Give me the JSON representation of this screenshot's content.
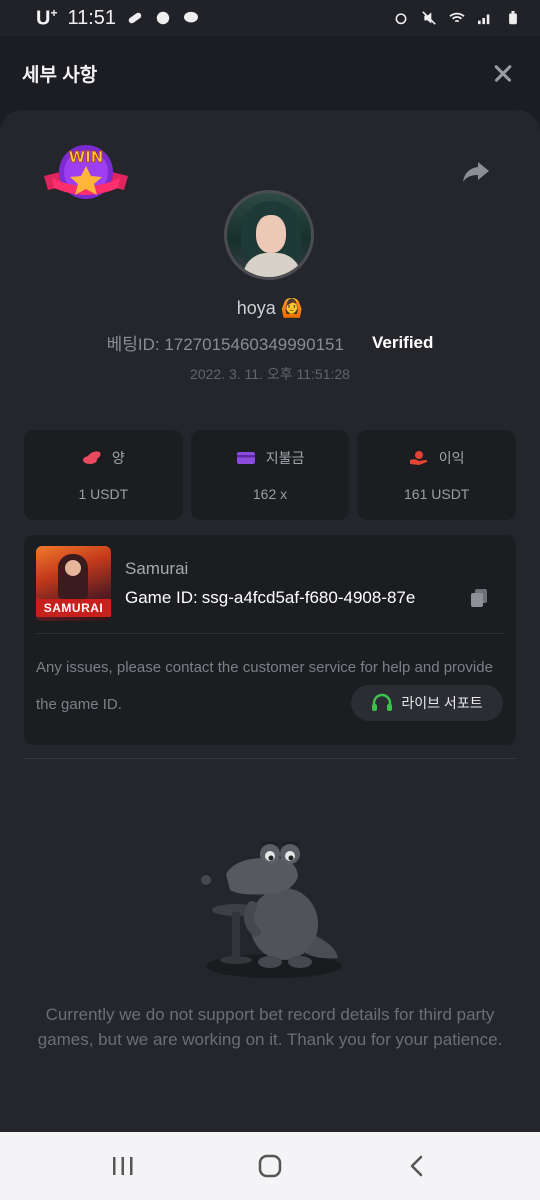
{
  "status_bar": {
    "carrier": "U",
    "carrier_sup": "+",
    "time": "11:51"
  },
  "header": {
    "title": "세부 사항"
  },
  "bet": {
    "username": "hoya 🙆",
    "bet_id": "베팅ID: 1727015460349990151",
    "verified": "Verified",
    "time": "2022. 3. 11. 오후 11:51:28"
  },
  "stats": [
    {
      "label": "양",
      "value": "1 USDT",
      "icon": "coins-icon",
      "color": "#e94a5f"
    },
    {
      "label": "지불금",
      "value": "162 x",
      "icon": "card-icon",
      "color": "#8b4bdc"
    },
    {
      "label": "이익",
      "value": "161 USDT",
      "icon": "hand-coin-icon",
      "color": "#e14437"
    }
  ],
  "game": {
    "thumb_label": "SAMURAI",
    "name": "Samurai",
    "id_label": "Game ID:",
    "id_value": "ssg-a4fcd5af-f680-4908-87e",
    "issue_text": "Any issues, please contact the customer service for help and provide the game ID.",
    "support_label": "라이브 서포트"
  },
  "notice": "Currently we do not support bet record details for third party games, but we are working on it. Thank you for your patience.",
  "colors": {
    "background": "#1b1d22",
    "card": "#24262b",
    "support_accent": "#3cc24a"
  }
}
